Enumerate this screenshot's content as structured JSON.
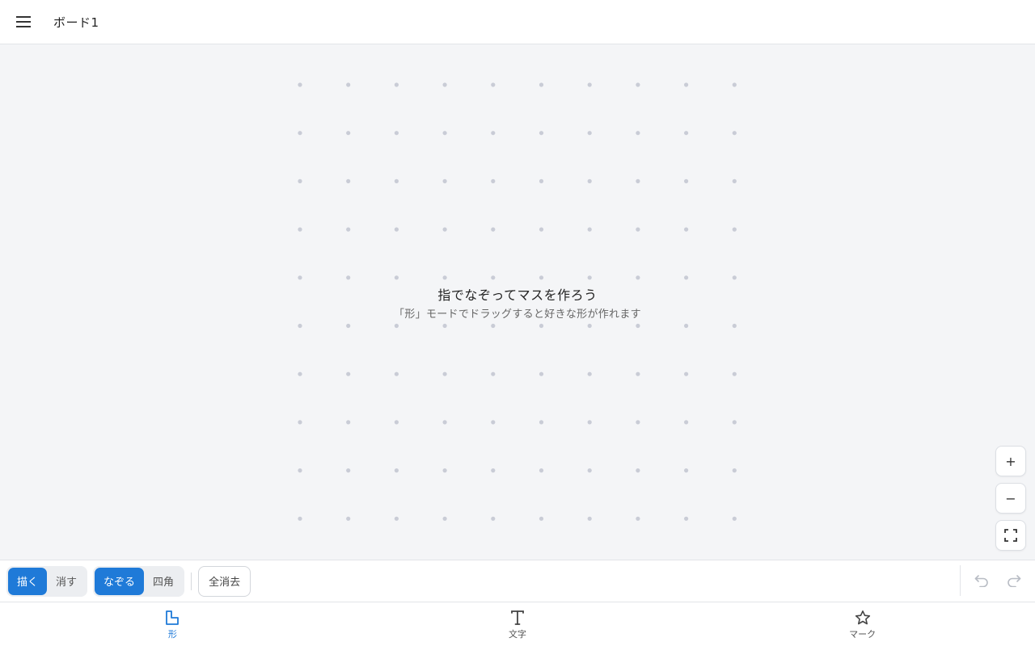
{
  "header": {
    "board_title": "ボード1"
  },
  "canvas": {
    "hint_title": "指でなぞってマスを作ろう",
    "hint_subtitle": "「形」モードでドラッグすると好きな形が作れます",
    "grid": {
      "columns": 10,
      "rows": 10,
      "dot_color": "#c9ccd6"
    }
  },
  "zoom": {
    "zoom_in_label": "+",
    "zoom_out_label": "−",
    "fit_icon": "fullscreen-icon"
  },
  "toolbar": {
    "draw_label": "描く",
    "erase_label": "消す",
    "trace_label": "なぞる",
    "rect_label": "四角",
    "clear_all_label": "全消去",
    "active_tool": "描く",
    "active_shape_mode": "なぞる"
  },
  "bottom_nav": {
    "items": [
      {
        "label": "形",
        "icon": "shape-icon",
        "active": true
      },
      {
        "label": "文字",
        "icon": "text-icon",
        "active": false
      },
      {
        "label": "マーク",
        "icon": "star-icon",
        "active": false
      }
    ]
  },
  "colors": {
    "accent": "#1f7ad8",
    "canvas_bg": "#f4f5f7",
    "disabled_icon": "#b8bcc4"
  }
}
